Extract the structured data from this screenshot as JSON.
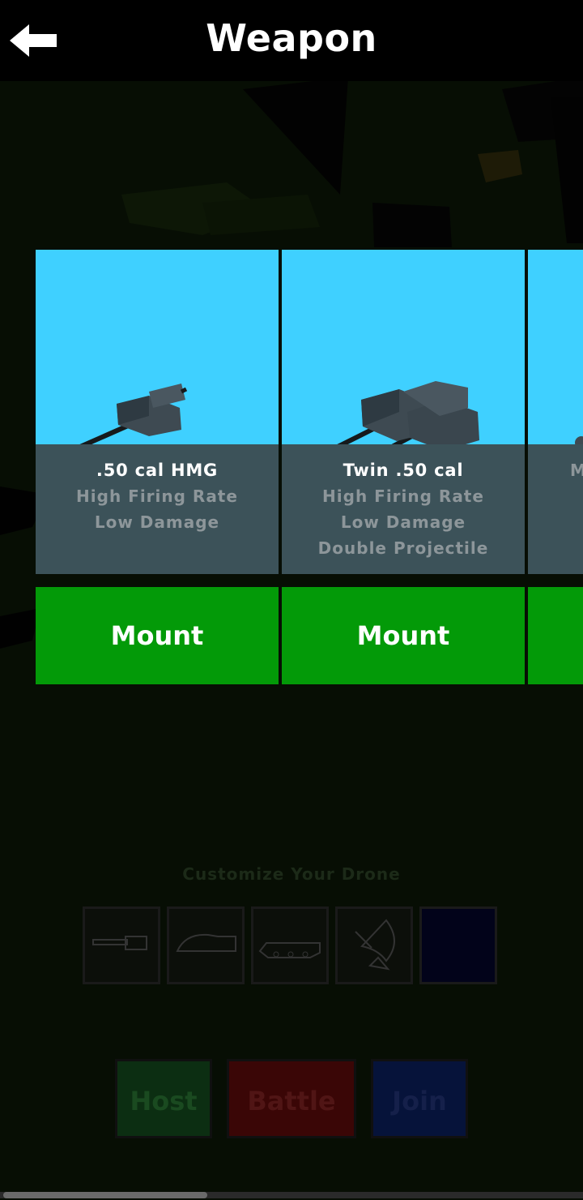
{
  "header": {
    "title": "Weapon",
    "back_icon": "back-arrow-icon"
  },
  "weapons": [
    {
      "name": ".50 cal HMG",
      "stats": [
        "High Firing Rate",
        "Low Damage"
      ],
      "button": "Mount"
    },
    {
      "name": "Twin .50 cal",
      "stats": [
        "High Firing Rate",
        "Low Damage",
        "Double Projectile"
      ],
      "button": "Mount"
    },
    {
      "name": "",
      "stats": [
        "M"
      ],
      "button": ""
    }
  ],
  "customize": {
    "label": "Customize Your Drone",
    "slots": [
      "gun-icon",
      "dome-icon",
      "tank-body-icon",
      "radar-dish-icon",
      "empty-slot"
    ]
  },
  "menu": {
    "host": "Host",
    "battle": "Battle",
    "join": "Join"
  },
  "colors": {
    "card_bg": "#3fd0ff",
    "mount_green": "#039a08",
    "host_green": "#0c2e12",
    "battle_red": "#3a0606",
    "join_blue": "#06133a"
  }
}
